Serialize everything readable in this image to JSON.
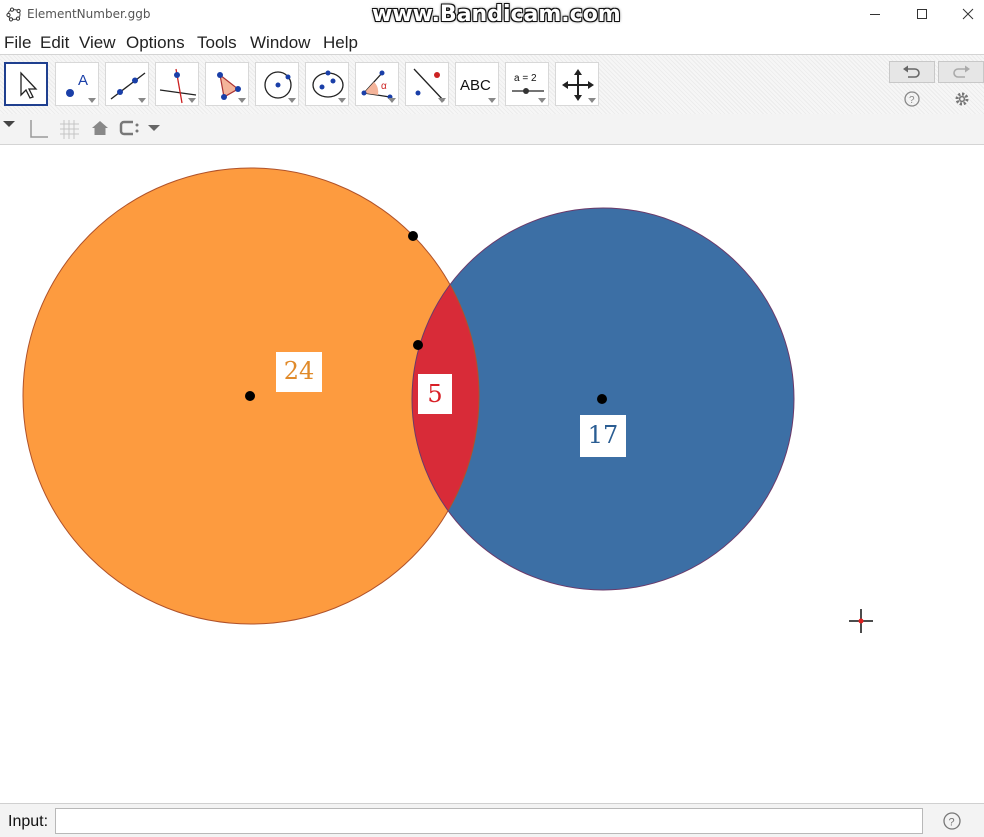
{
  "window": {
    "title": "ElementNumber.ggb",
    "watermark": "www.Bandicam.com"
  },
  "menu": [
    "File",
    "Edit",
    "View",
    "Options",
    "Tools",
    "Window",
    "Help"
  ],
  "toolbar": {
    "tools": [
      {
        "name": "move-tool",
        "label": ""
      },
      {
        "name": "point-tool",
        "label": "A"
      },
      {
        "name": "line-tool",
        "label": ""
      },
      {
        "name": "perpendicular-line-tool",
        "label": ""
      },
      {
        "name": "polygon-tool",
        "label": ""
      },
      {
        "name": "circle-center-point-tool",
        "label": ""
      },
      {
        "name": "ellipse-tool",
        "label": ""
      },
      {
        "name": "angle-tool",
        "label": "α"
      },
      {
        "name": "reflect-tool",
        "label": ""
      },
      {
        "name": "text-tool",
        "label": "ABC"
      },
      {
        "name": "slider-tool",
        "label": "a = 2"
      },
      {
        "name": "move-graphics-view-tool",
        "label": ""
      }
    ]
  },
  "canvas": {
    "circles": [
      {
        "name": "orange-circle",
        "fill": "#fd9b3f",
        "stroke": "#b0522a"
      },
      {
        "name": "blue-circle",
        "fill": "#3c6fa5",
        "stroke": "#6a3a6a"
      }
    ],
    "intersection_fill": "#d82b38",
    "labels": {
      "orange": {
        "text": "24",
        "color": "#e08a2a"
      },
      "intersection": {
        "text": "5",
        "color": "#d81f26"
      },
      "blue": {
        "text": "17",
        "color": "#2a5d93"
      }
    }
  },
  "input": {
    "label": "Input:",
    "value": ""
  },
  "icons": {
    "help": "help-icon",
    "settings": "gear-icon",
    "undo": "undo-icon",
    "redo": "redo-icon"
  }
}
